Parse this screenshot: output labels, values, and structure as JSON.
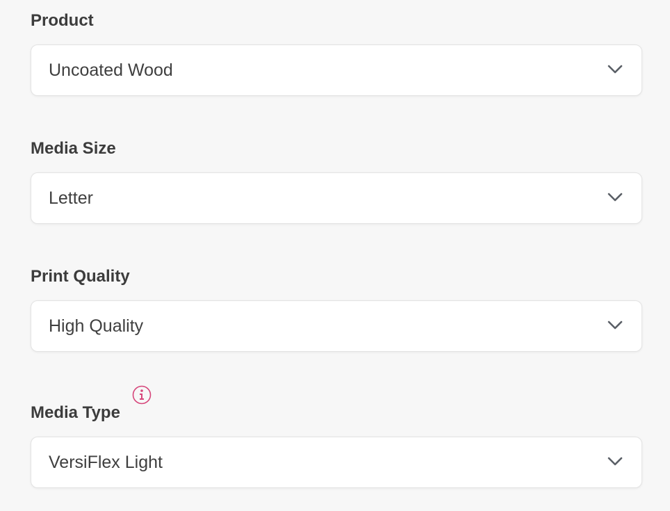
{
  "fields": [
    {
      "label": "Product",
      "value": "Uncoated Wood"
    },
    {
      "label": "Media Size",
      "value": "Letter"
    },
    {
      "label": "Print Quality",
      "value": "High Quality"
    },
    {
      "label": "Media Type",
      "value": "VersiFlex Light"
    }
  ],
  "icons": {
    "info": "info-circle-icon",
    "dropdown": "chevron-down-icon"
  },
  "colors": {
    "background": "#f7f7f7",
    "info_accent": "#d6457a",
    "label_text": "#3c3c3c",
    "chevron": "#5a5f66"
  }
}
